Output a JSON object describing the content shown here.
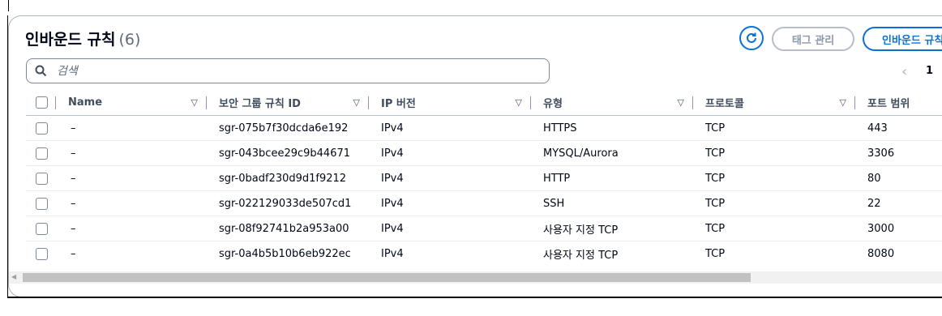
{
  "header": {
    "title": "인바운드 규칙",
    "count": "(6)",
    "tag_button": "태그 관리",
    "edit_button": "인바운드 규칙 편집"
  },
  "search": {
    "placeholder": "검색"
  },
  "pagination": {
    "current_page": "1"
  },
  "table": {
    "columns": [
      "Name",
      "보안 그룹 규칙 ID",
      "IP 버전",
      "유형",
      "프로토콜",
      "포트 범위"
    ],
    "rows": [
      {
        "name": "–",
        "rule_id": "sgr-075b7f30dcda6e192",
        "ip_version": "IPv4",
        "type": "HTTPS",
        "protocol": "TCP",
        "port_range": "443"
      },
      {
        "name": "–",
        "rule_id": "sgr-043bcee29c9b44671",
        "ip_version": "IPv4",
        "type": "MYSQL/Aurora",
        "protocol": "TCP",
        "port_range": "3306"
      },
      {
        "name": "–",
        "rule_id": "sgr-0badf230d9d1f9212",
        "ip_version": "IPv4",
        "type": "HTTP",
        "protocol": "TCP",
        "port_range": "80"
      },
      {
        "name": "–",
        "rule_id": "sgr-022129033de507cd1",
        "ip_version": "IPv4",
        "type": "SSH",
        "protocol": "TCP",
        "port_range": "22"
      },
      {
        "name": "–",
        "rule_id": "sgr-08f92741b2a953a00",
        "ip_version": "IPv4",
        "type": "사용자 지정 TCP",
        "protocol": "TCP",
        "port_range": "3000"
      },
      {
        "name": "–",
        "rule_id": "sgr-0a4b5b10b6eb922ec",
        "ip_version": "IPv4",
        "type": "사용자 지정 TCP",
        "protocol": "TCP",
        "port_range": "8080"
      }
    ]
  },
  "colors": {
    "accent": "#0972d3",
    "border": "#aab7b8",
    "text": "#000716"
  }
}
